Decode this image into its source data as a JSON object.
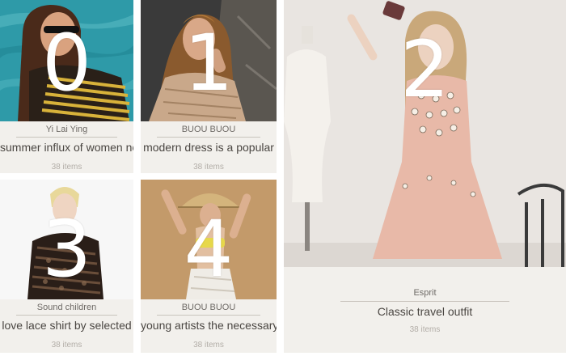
{
  "cards": [
    {
      "number": "0",
      "brand": "Yi Lai Ying",
      "title": "summer influx of women ne",
      "count": "38 items"
    },
    {
      "number": "1",
      "brand": "BUOU BUOU",
      "title": "modern dress is a popular",
      "count": "38 items"
    },
    {
      "number": "2",
      "brand": "Esprit",
      "title": "Classic travel outfit",
      "count": "38 items"
    },
    {
      "number": "3",
      "brand": "Sound children",
      "title": "love lace shirt by selected",
      "count": "38 items"
    },
    {
      "number": "4",
      "brand": "BUOU BUOU",
      "title": "young artists the necessary",
      "count": "38 items"
    }
  ]
}
